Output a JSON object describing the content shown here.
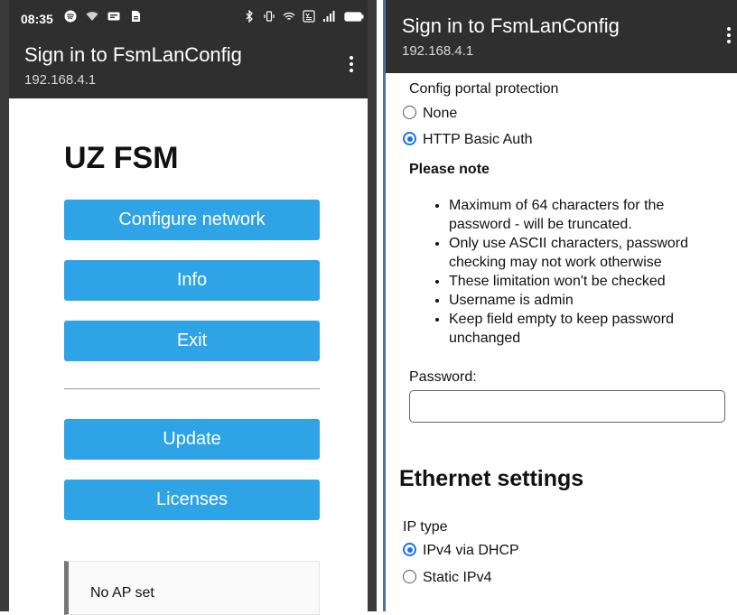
{
  "left": {
    "status": {
      "time": "08:35"
    },
    "appbar": {
      "title": "Sign in to FsmLanConfig",
      "subtitle": "192.168.4.1"
    },
    "heading": "UZ FSM",
    "buttons": {
      "configure": "Configure network",
      "info": "Info",
      "exit": "Exit",
      "update": "Update",
      "licenses": "Licenses"
    },
    "message": "No AP set"
  },
  "right": {
    "appbar": {
      "title": "Sign in to FsmLanConfig",
      "subtitle": "192.168.4.1"
    },
    "protection": {
      "label": "Config portal protection",
      "option_none": "None",
      "option_basic": "HTTP Basic Auth",
      "selected": "HTTP Basic Auth"
    },
    "note": {
      "title": "Please note",
      "items": [
        "Maximum of 64 characters for the password - will be truncated.",
        "Only use ASCII characters, password checking may not work otherwise",
        "These limitation won't be checked",
        "Username is admin",
        "Keep field empty to keep password unchanged"
      ]
    },
    "password": {
      "label": "Password:",
      "value": ""
    },
    "ethernet": {
      "heading": "Ethernet settings",
      "ip_type_label": "IP type",
      "option_dhcp": "IPv4 via DHCP",
      "option_static": "Static IPv4",
      "selected": "IPv4 via DHCP"
    }
  },
  "colors": {
    "accent": "#2ea3e5",
    "appbar": "#2f2f2f",
    "radio_selected": "#1a73e8"
  },
  "icons": [
    "spotify-icon",
    "wifi-icon",
    "message-icon",
    "document-icon",
    "bluetooth-icon",
    "vibrate-icon",
    "wifi-calling-icon",
    "volte-icon",
    "signal-icon",
    "battery-icon",
    "more-vert-icon"
  ]
}
